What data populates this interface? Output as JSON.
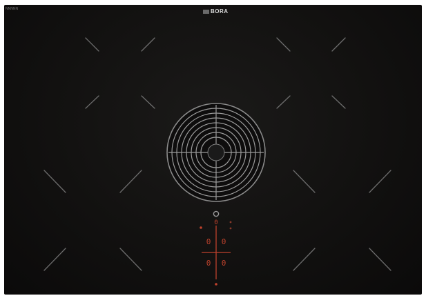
{
  "brand": "BORA",
  "corner_label": "NNNNN",
  "colors": {
    "surface": "#121110",
    "zone_markers": "#6d6d6d",
    "grille": "#a0a0a0",
    "controls": "#c0422c"
  },
  "display": {
    "top_digit": "0",
    "left_upper_digit": "0",
    "right_upper_digit": "0",
    "left_lower_digit": "0",
    "right_lower_digit": "0"
  }
}
